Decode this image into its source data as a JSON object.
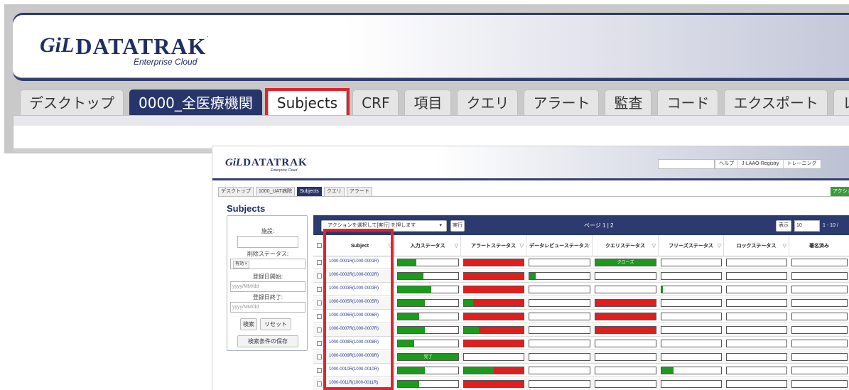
{
  "top": {
    "logo": {
      "mark": "GiL",
      "name": "DATATRAK",
      "sub": "Enterprise Cloud",
      "tm": "·"
    },
    "tabs": [
      {
        "label": "デスクトップ",
        "style": "normal"
      },
      {
        "label": "0000_全医療機関",
        "style": "site"
      },
      {
        "label": "Subjects",
        "style": "selected"
      },
      {
        "label": "CRF",
        "style": "normal"
      },
      {
        "label": "項目",
        "style": "normal"
      },
      {
        "label": "クエリ",
        "style": "normal"
      },
      {
        "label": "アラート",
        "style": "normal"
      },
      {
        "label": "監査",
        "style": "normal"
      },
      {
        "label": "コード",
        "style": "normal"
      },
      {
        "label": "エクスポート",
        "style": "normal"
      },
      {
        "label": "レポート",
        "style": "normal"
      }
    ]
  },
  "bottom": {
    "logo": {
      "mark": "GiL",
      "name": "DATATRAK",
      "sub": "Enterprise Cloud"
    },
    "toplinks": [
      "ヘルプ",
      "J-LAAO-Registry",
      "トレーニング"
    ],
    "tabs": [
      {
        "label": "デスクトップ",
        "style": "normal"
      },
      {
        "label": "1000_UAT病院",
        "style": "normal"
      },
      {
        "label": "Subjects",
        "style": "dark"
      },
      {
        "label": "クエリ",
        "style": "normal"
      },
      {
        "label": "アラート",
        "style": "normal"
      }
    ],
    "action_button": "アクション",
    "page_title": "Subjects",
    "filter": {
      "site_label": "施設:",
      "delete_status_label": "削除ステータス:",
      "delete_status_chip": "有効 ×",
      "reg_start_label": "登録日開始:",
      "reg_start_placeholder": "yyyy/MM/dd",
      "reg_end_label": "登録日終了:",
      "reg_end_placeholder": "yyyy/MM/dd",
      "search_button": "検索",
      "reset_button": "リセット",
      "save_button": "検索条件の保存"
    },
    "grid": {
      "action_select": "アクションを選択して[実行] を押します",
      "caret": "▾",
      "run_button": "実行",
      "page_info": "ページ 1 | 2",
      "show_button": "表示",
      "page_size": "10",
      "range": "1 - 10 /",
      "filter_icon": "▽",
      "columns": [
        "Subject",
        "入力ステータス",
        "アラートステータス",
        "データレビューステータス",
        "クエリステータス",
        "フリーズステータス",
        "ロックステータス",
        "署名済み"
      ],
      "rows": [
        {
          "subject": "1000-0001R(1000-0001R)",
          "input": {
            "g": 0.3
          },
          "alert": {
            "r": 1
          },
          "review": {},
          "query": {
            "g": 1,
            "text": "クローズ"
          },
          "freeze": {},
          "lock": {},
          "sign": {}
        },
        {
          "subject": "1000-0002R(1000-0002R)",
          "input": {
            "g": 0.42
          },
          "alert": {
            "r": 1
          },
          "review": {
            "g": 0.1
          },
          "query": {},
          "freeze": {},
          "lock": {},
          "sign": {}
        },
        {
          "subject": "1000-0003R(1000-0003R)",
          "input": {
            "g": 0.55
          },
          "alert": {
            "r": 1
          },
          "review": {},
          "query": {},
          "freeze": {
            "g": 0.02
          },
          "lock": {},
          "sign": {}
        },
        {
          "subject": "1000-0005R(1000-0005R)",
          "input": {
            "g": 0.45
          },
          "alert": {
            "g": 0.15,
            "r": 0.85
          },
          "review": {},
          "query": {
            "r": 1
          },
          "freeze": {},
          "lock": {},
          "sign": {}
        },
        {
          "subject": "1000-0006R(1000-0006R)",
          "input": {
            "g": 0.35
          },
          "alert": {
            "r": 1
          },
          "review": {},
          "query": {
            "r": 1
          },
          "freeze": {},
          "lock": {},
          "sign": {}
        },
        {
          "subject": "1000-0007R(1000-0007R)",
          "input": {
            "g": 0.45
          },
          "alert": {
            "g": 0.25,
            "r": 0.75
          },
          "review": {},
          "query": {
            "r": 1
          },
          "freeze": {},
          "lock": {},
          "sign": {}
        },
        {
          "subject": "1000-0008R(1000-0008R)",
          "input": {
            "g": 0.27
          },
          "alert": {
            "r": 1
          },
          "review": {},
          "query": {},
          "freeze": {},
          "lock": {},
          "sign": {}
        },
        {
          "subject": "1000-0009R(1000-0009R)",
          "input": {
            "g": 1,
            "text": "完了"
          },
          "alert": {},
          "review": {},
          "query": {},
          "freeze": {},
          "lock": {},
          "sign": {}
        },
        {
          "subject": "1000-0010R(1000-0010R)",
          "input": {
            "g": 0.45
          },
          "alert": {
            "g": 0.5,
            "r": 0.5
          },
          "review": {},
          "query": {},
          "freeze": {
            "g": 0.2
          },
          "lock": {},
          "sign": {}
        },
        {
          "subject": "1000-0011R(1000-0011R)",
          "input": {
            "g": 0.35
          },
          "alert": {
            "r": 1
          },
          "review": {},
          "query": {},
          "freeze": {},
          "lock": {},
          "sign": {}
        }
      ]
    }
  },
  "colors": {
    "navy": "#27356a",
    "green": "#1b9a1b",
    "red": "#e01e1e",
    "highlight": "#e0242c"
  }
}
